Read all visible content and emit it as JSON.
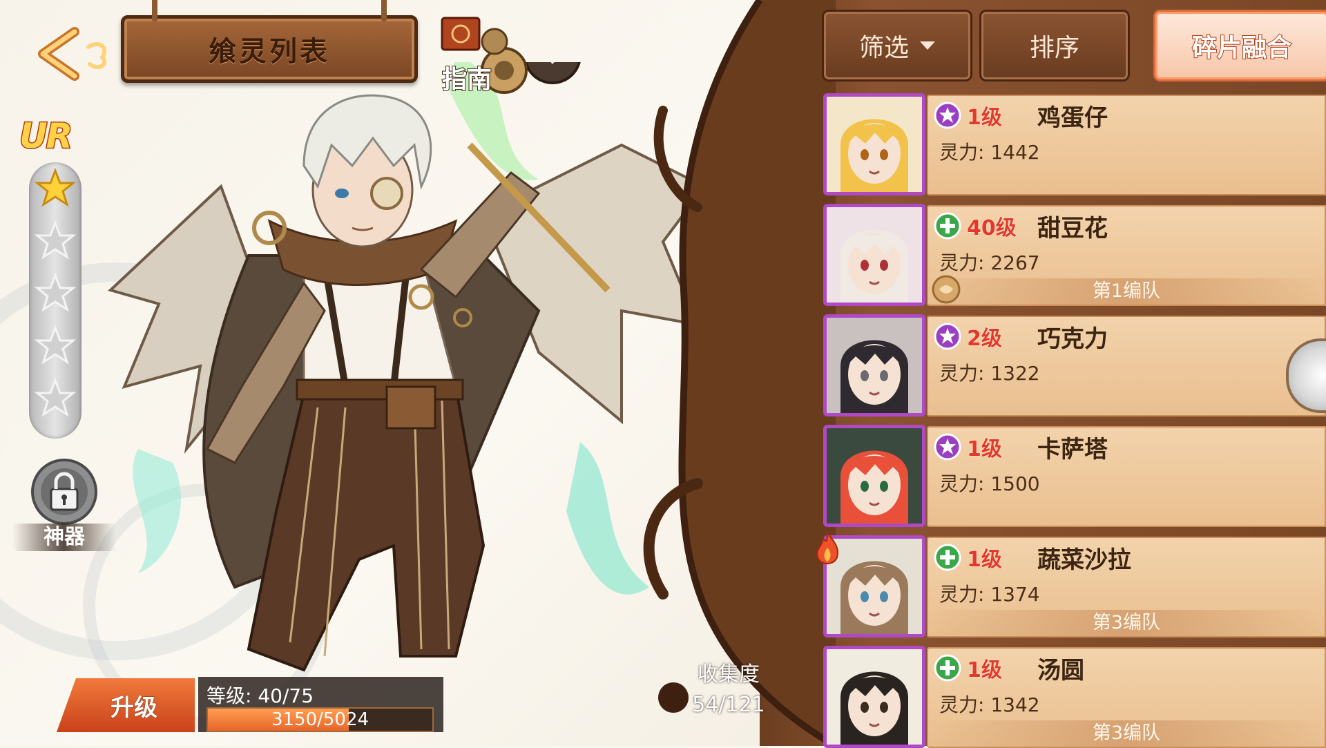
{
  "header": {
    "title": "飨灵列表",
    "guide_label": "指南"
  },
  "hero": {
    "rarity": "UR",
    "stars_filled": 1,
    "stars_total": 5,
    "artifact_label": "神器",
    "upgrade_label": "升级",
    "level_text": "等级: 40/75",
    "exp_current": 3150,
    "exp_max": 5024,
    "exp_text": "3150/5024"
  },
  "collection": {
    "label": "收集度",
    "value": "54/121"
  },
  "toolbar": {
    "filter_label": "筛选",
    "sort_label": "排序",
    "fuse_label": "碎片融合"
  },
  "cards": [
    {
      "level": "1级",
      "name": "鸡蛋仔",
      "power": "灵力: 1442",
      "team": "",
      "type": "star",
      "fire": false
    },
    {
      "level": "40级",
      "name": "甜豆花",
      "power": "灵力: 2267",
      "team": "第1编队",
      "type": "plus",
      "fire": false
    },
    {
      "level": "2级",
      "name": "巧克力",
      "power": "灵力: 1322",
      "team": "",
      "type": "star",
      "fire": false
    },
    {
      "level": "1级",
      "name": "卡萨塔",
      "power": "灵力: 1500",
      "team": "",
      "type": "star",
      "fire": false
    },
    {
      "level": "1级",
      "name": "蔬菜沙拉",
      "power": "灵力: 1374",
      "team": "第3编队",
      "type": "plus",
      "fire": true
    },
    {
      "level": "1级",
      "name": "汤圆",
      "power": "灵力: 1342",
      "team": "第3编队",
      "type": "plus",
      "fire": false
    }
  ],
  "colors": {
    "star_type": "#9b3fc2",
    "plus_type": "#3aa84a",
    "level_text": "#e23a2a",
    "portrait_frame": "#b04ac4"
  }
}
